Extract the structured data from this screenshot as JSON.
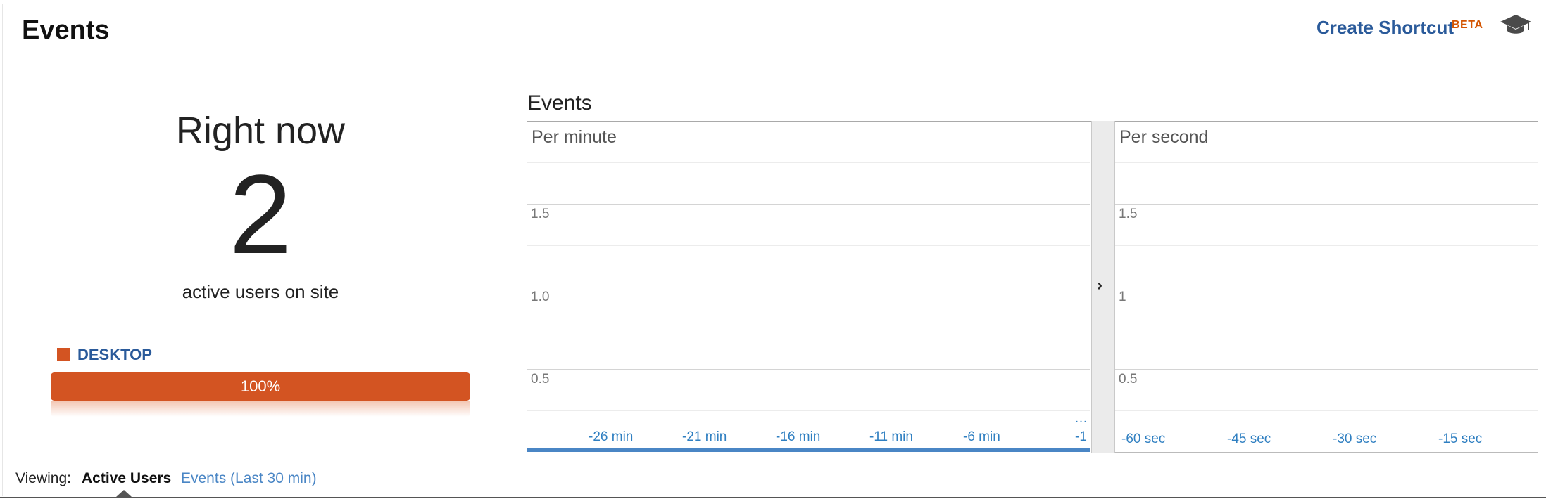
{
  "header": {
    "title": "Events",
    "shortcut_label": "Create Shortcut",
    "beta_label": "BETA",
    "icon": "graduation-cap-icon"
  },
  "summary": {
    "heading": "Right now",
    "count": "2",
    "subtitle": "active users on site",
    "device": {
      "label": "DESKTOP",
      "percent_label": "100%",
      "share": 1.0,
      "color": "#d35422"
    }
  },
  "chart": {
    "title": "Events",
    "per_minute_label": "Per minute",
    "per_second_label": "Per second",
    "toggle_icon": "chevron-right-icon",
    "accent": "#4a86c5"
  },
  "chart_data": [
    {
      "type": "bar",
      "title": "Per minute",
      "y_ticks": [
        "1.5",
        "1.0",
        "0.5"
      ],
      "x_ticks": [
        "-26 min",
        "-21 min",
        "-16 min",
        "-11 min",
        "-6 min",
        "-1"
      ],
      "overflow_marker": "…",
      "ylim": [
        0,
        2
      ],
      "values": []
    },
    {
      "type": "bar",
      "title": "Per second",
      "y_ticks": [
        "1.5",
        "1",
        "0.5"
      ],
      "x_ticks": [
        "-60 sec",
        "-45 sec",
        "-30 sec",
        "-15 sec"
      ],
      "ylim": [
        0,
        2
      ],
      "values": []
    }
  ],
  "footer": {
    "viewing_label": "Viewing:",
    "tabs": [
      {
        "label": "Active Users",
        "active": true
      },
      {
        "label": "Events (Last 30 min)",
        "active": false
      }
    ]
  }
}
